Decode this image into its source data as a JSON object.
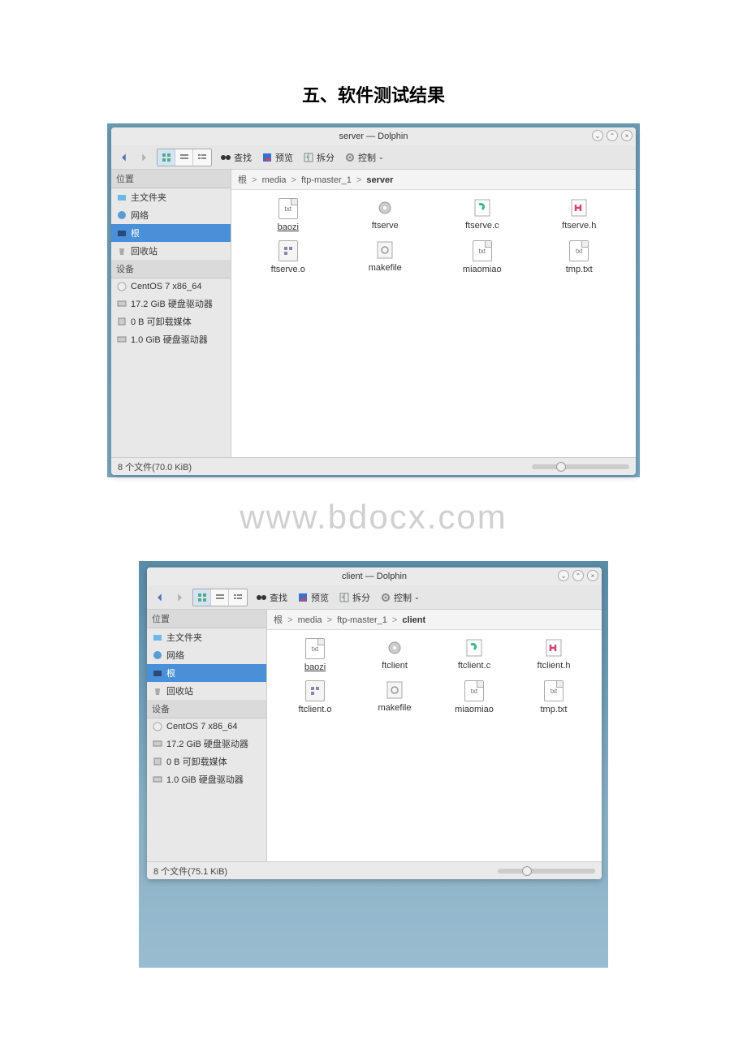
{
  "doc_title": "五、软件测试结果",
  "watermark": "www.bdocx.com",
  "window1": {
    "title": "server — Dolphin",
    "toolbar": {
      "find": "查找",
      "preview": "预览",
      "split": "拆分",
      "control": "控制"
    },
    "sidebar": {
      "section_places": "位置",
      "home": "主文件夹",
      "network": "网络",
      "root": "根",
      "trash": "回收站",
      "section_devices": "设备",
      "dev1": "CentOS 7 x86_64",
      "dev2": "17.2 GiB 硬盘驱动器",
      "dev3": "0 B 可卸载媒体",
      "dev4": "1.0 GiB 硬盘驱动器"
    },
    "breadcrumb": {
      "p1": "根",
      "p2": "media",
      "p3": "ftp-master_1",
      "p4": "server"
    },
    "files": {
      "f1": "baozi",
      "f2": "ftserve",
      "f3": "ftserve.c",
      "f4": "ftserve.h",
      "f5": "ftserve.o",
      "f6": "makefile",
      "f7": "miaomiao",
      "f8": "tmp.txt"
    },
    "status": "8 个文件(70.0 KiB)"
  },
  "window2": {
    "title": "client — Dolphin",
    "toolbar": {
      "find": "查找",
      "preview": "预览",
      "split": "拆分",
      "control": "控制"
    },
    "sidebar": {
      "section_places": "位置",
      "home": "主文件夹",
      "network": "网络",
      "root": "根",
      "trash": "回收站",
      "section_devices": "设备",
      "dev1": "CentOS 7 x86_64",
      "dev2": "17.2 GiB 硬盘驱动器",
      "dev3": "0 B 可卸载媒体",
      "dev4": "1.0 GiB 硬盘驱动器"
    },
    "breadcrumb": {
      "p1": "根",
      "p2": "media",
      "p3": "ftp-master_1",
      "p4": "client"
    },
    "files": {
      "f1": "baozi",
      "f2": "ftclient",
      "f3": "ftclient.c",
      "f4": "ftclient.h",
      "f5": "ftclient.o",
      "f6": "makefile",
      "f7": "miaomiao",
      "f8": "tmp.txt"
    },
    "status": "8 个文件(75.1 KiB)"
  }
}
